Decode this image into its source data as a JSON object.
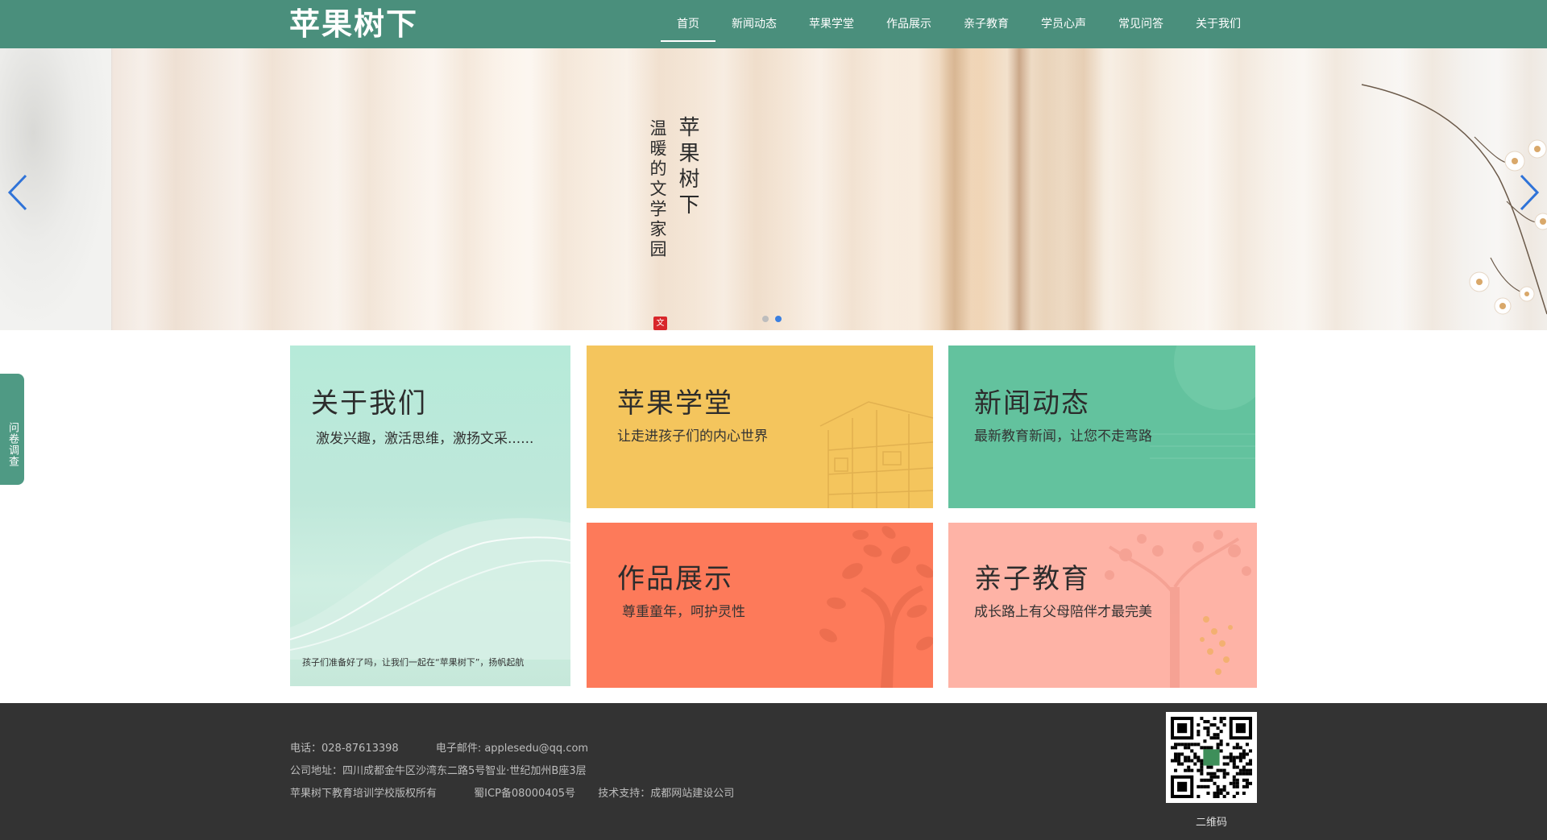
{
  "header": {
    "logo": "苹果树下",
    "nav": [
      "首页",
      "新闻动态",
      "苹果学堂",
      "作品展示",
      "亲子教育",
      "学员心声",
      "常见问答",
      "关于我们"
    ],
    "active_index": 0
  },
  "banner": {
    "title": "苹果树下",
    "subtitle": "温暖的文学家园",
    "seal": "文",
    "slide_count": 2,
    "active_slide": 1
  },
  "side_tab": {
    "label": "问卷调查"
  },
  "tiles": {
    "about": {
      "title": "关于我们",
      "subtitle": "激发兴趣，激活思维，激扬文采......",
      "footer": "孩子们准备好了吗，让我们一起在“苹果树下”，扬帆起航"
    },
    "school": {
      "title": "苹果学堂",
      "subtitle": "让走进孩子们的内心世界"
    },
    "news": {
      "title": "新闻动态",
      "subtitle": "最新教育新闻，让您不走弯路"
    },
    "works": {
      "title": "作品展示",
      "subtitle": "尊重童年，呵护灵性"
    },
    "parent": {
      "title": "亲子教育",
      "subtitle": "成长路上有父母陪伴才最完美"
    }
  },
  "footer": {
    "phone": "电话：028-87613398",
    "email": "电子邮件: applesedu@qq.com",
    "address": "公司地址：四川成都金牛区沙湾东二路5号智业·世纪加州B座3层",
    "copyright": "苹果树下教育培训学校版权所有",
    "icp": "蜀ICP备08000405号",
    "support": "技术支持：成都网站建设公司",
    "qr_label": "二维码"
  },
  "colors": {
    "header_bg": "#4a8f7c",
    "about": "#b6ead9",
    "school": "#f4c55d",
    "news": "#63c29e",
    "works": "#fd7a5a",
    "parent": "#feb3a6",
    "footer_bg": "#333333",
    "dot_active": "#3a7fe0"
  }
}
